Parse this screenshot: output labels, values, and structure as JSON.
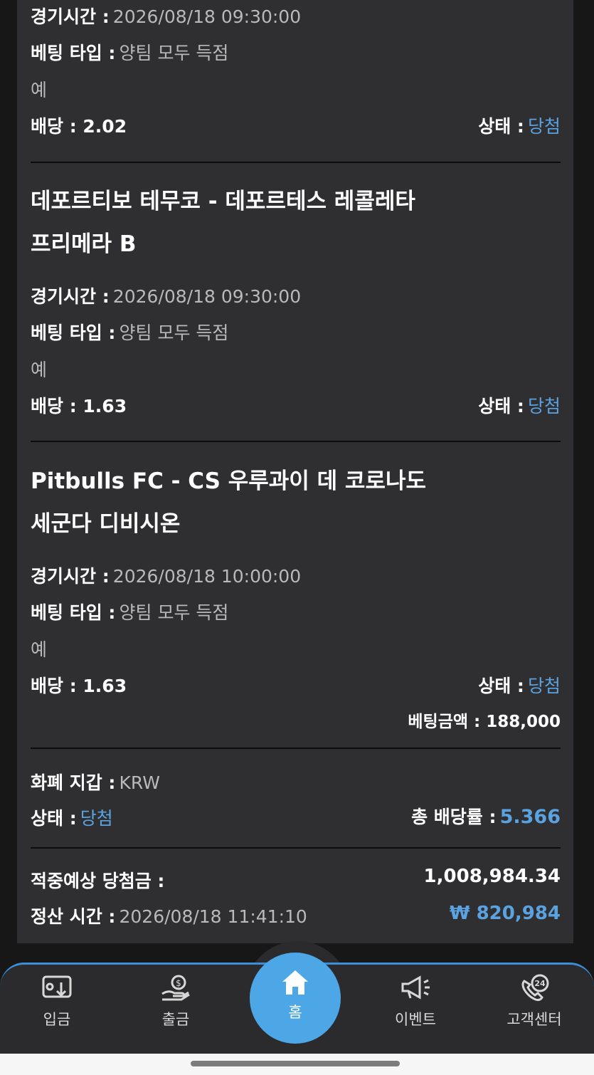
{
  "bet1": {
    "time_label": "경기시간 :",
    "time_value": "2026/08/18 09:30:00",
    "type_label": "베팅 타입 :",
    "type_value": "양팀 모두 득점",
    "pick": "예",
    "odds": "배당 : 2.02",
    "status_label": "상태 :",
    "status_value": "당첨"
  },
  "bet2": {
    "title_line1": "데포르티보 테무코 - 데포르테스 레콜레타",
    "title_line2": "프리메라 B",
    "time_label": "경기시간 :",
    "time_value": "2026/08/18 09:30:00",
    "type_label": "베팅 타입 :",
    "type_value": "양팀 모두 득점",
    "pick": "예",
    "odds": "배당 : 1.63",
    "status_label": "상태 :",
    "status_value": "당첨"
  },
  "bet3": {
    "title_line1": "Pitbulls FC - CS 우루과이 데 코로나도",
    "title_line2": "세군다 디비시온",
    "time_label": "경기시간 :",
    "time_value": "2026/08/18 10:00:00",
    "type_label": "베팅 타입 :",
    "type_value": "양팀 모두 득점",
    "pick": "예",
    "odds": "배당 : 1.63",
    "status_label": "상태 :",
    "status_value": "당첨",
    "bet_amount": "베팅금액 : 188,000"
  },
  "summary": {
    "currency_label": "화폐 지갑 :",
    "currency_value": "KRW",
    "status_label": "상태 :",
    "status_value": "당첨",
    "total_odds_label": "총 배당률 :",
    "total_odds_value": "5.366",
    "expected_label": "적중예상 당첨금 :",
    "expected_value": "1,008,984.34",
    "settle_label": "정산 시간 :",
    "settle_value": "2026/08/18 11:41:10",
    "payout": "₩ 820,984"
  },
  "nav": {
    "deposit": "입금",
    "withdraw": "출금",
    "home": "홈",
    "event": "이벤트",
    "support": "고객센터",
    "support_badge": "24"
  },
  "colors": {
    "accent": "#4da7e6",
    "status_blue": "#5aa2e0",
    "card_bg": "#2f2f31"
  }
}
